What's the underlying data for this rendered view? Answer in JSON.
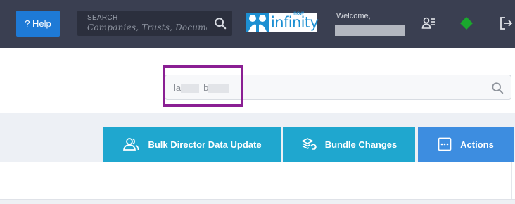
{
  "header": {
    "help_label": "? Help",
    "search_label": "SEARCH",
    "search_placeholder": "Companies, Trusts, Documents",
    "logo_now": "now",
    "logo_name": "infinity",
    "welcome": "Welcome,",
    "icons": [
      "user-list-icon",
      "diamond-icon",
      "logout-icon"
    ]
  },
  "main_search": {
    "value_start": "la",
    "value_mid": "b"
  },
  "toolbar": {
    "bulk_label": "Bulk Director Data Update",
    "bundle_label": "Bundle Changes",
    "actions_label": "Actions"
  },
  "colors": {
    "header_bg": "#3a3f51",
    "help_blue": "#1e7ad6",
    "teal": "#1fa7cf",
    "actions_blue": "#3d8de0",
    "highlight": "#8a1f93",
    "green": "#1aa82d"
  }
}
